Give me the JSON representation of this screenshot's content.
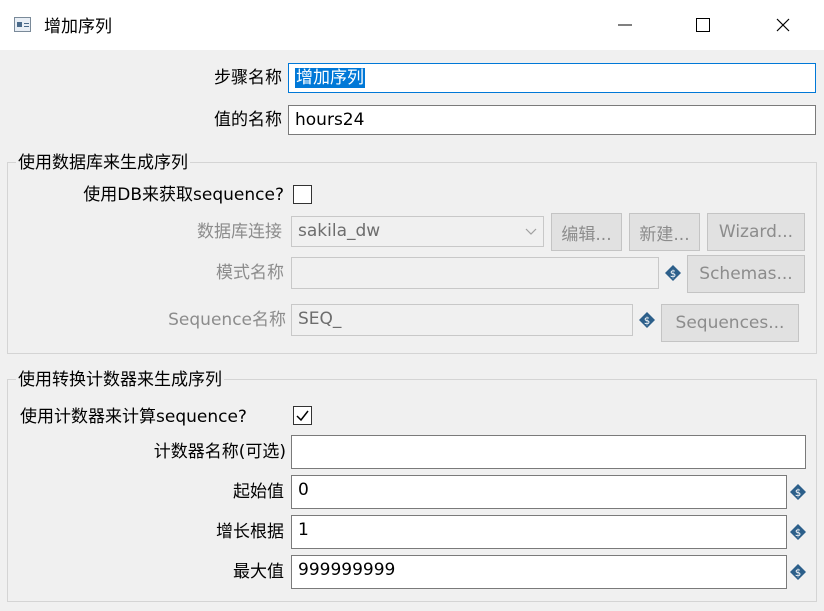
{
  "window": {
    "title": "增加序列",
    "icon": "app-window-icon",
    "controls": [
      "minimize-icon",
      "maximize-icon",
      "close-icon"
    ]
  },
  "step": {
    "name_label": "步骤名称",
    "name_value": "增加序列",
    "value_name_label": "值的名称",
    "value_name_value": "hours24"
  },
  "db_group": {
    "title": "使用数据库来生成序列",
    "use_db_label": "使用DB来获取sequence?",
    "use_db_checked": false,
    "connection_label": "数据库连接",
    "connection_value": "sakila_dw",
    "edit_button": "编辑...",
    "new_button": "新建...",
    "wizard_button": "Wizard...",
    "schema_label": "模式名称",
    "schema_value": "",
    "schemas_button": "Schemas...",
    "sequence_label": "Sequence名称",
    "sequence_value": "SEQ_",
    "sequences_button": "Sequences..."
  },
  "counter_group": {
    "title": "使用转换计数器来生成序列",
    "use_counter_label": "使用计数器来计算sequence?",
    "use_counter_checked": true,
    "counter_name_label": "计数器名称(可选)",
    "counter_name_value": "",
    "start_label": "起始值",
    "start_value": "0",
    "increment_label": "增长根据",
    "increment_value": "1",
    "max_label": "最大值",
    "max_value": "999999999"
  },
  "colors": {
    "accent": "#0078d7",
    "variable_icon": "#2c5f8a",
    "disabled_text": "#8c8c8c"
  }
}
